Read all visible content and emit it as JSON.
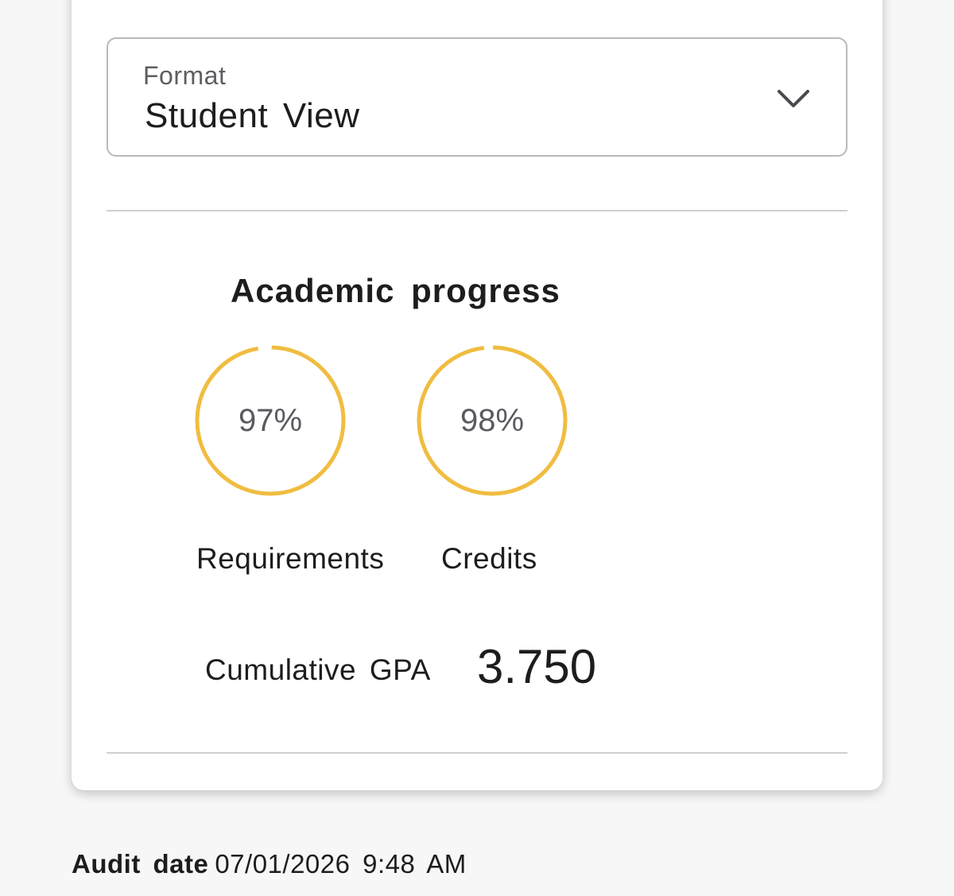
{
  "format_select": {
    "label": "Format",
    "value": "Student View",
    "icon": "chevron-down-icon"
  },
  "progress": {
    "title": "Academic progress",
    "accent_color": "#f0bd40",
    "requirements": {
      "value_text": "97%",
      "percent": 97,
      "label": "Requirements"
    },
    "credits": {
      "value_text": "98%",
      "percent": 98,
      "label": "Credits"
    }
  },
  "gpa": {
    "label": "Cumulative GPA",
    "value": "3.750"
  },
  "audit": {
    "label": "Audit date",
    "value": "07/01/2026 9:48 AM"
  }
}
